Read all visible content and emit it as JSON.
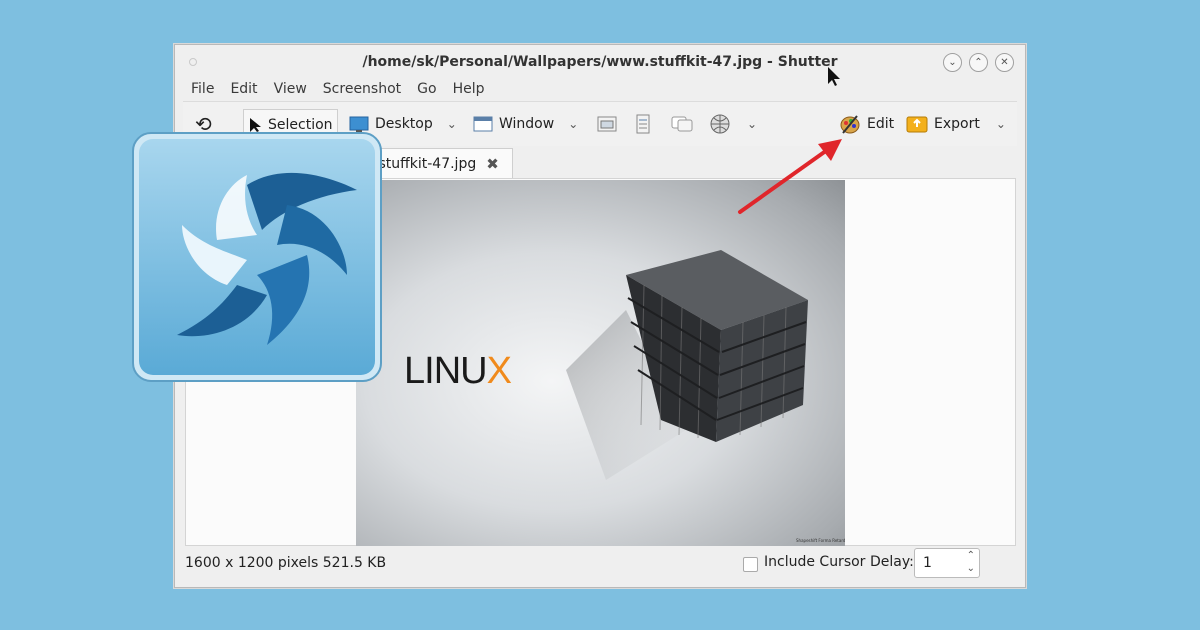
{
  "window": {
    "title": "/home/sk/Personal/Wallpapers/www.stuffkit-47.jpg - Shutter"
  },
  "menu": [
    "File",
    "Edit",
    "View",
    "Screenshot",
    "Go",
    "Help"
  ],
  "toolbar": {
    "selection": "Selection",
    "desktop": "Desktop",
    "window": "Window",
    "edit": "Edit",
    "export": "Export"
  },
  "tab": {
    "label": ".stuffkit-47.jpg"
  },
  "image": {
    "logo_text": "LINUX",
    "credit": "Shapeshift Forma Retard"
  },
  "status": {
    "info": "1600 x 1200 pixels  521.5 KB",
    "include_cursor": "Include Cursor",
    "include_cursor_checked": false,
    "delay_label": "Delay:",
    "delay_value": "1"
  },
  "colors": {
    "background": "#7ebfe0",
    "arrow": "#e0262b",
    "icon_blue": "#2f7fb6"
  }
}
